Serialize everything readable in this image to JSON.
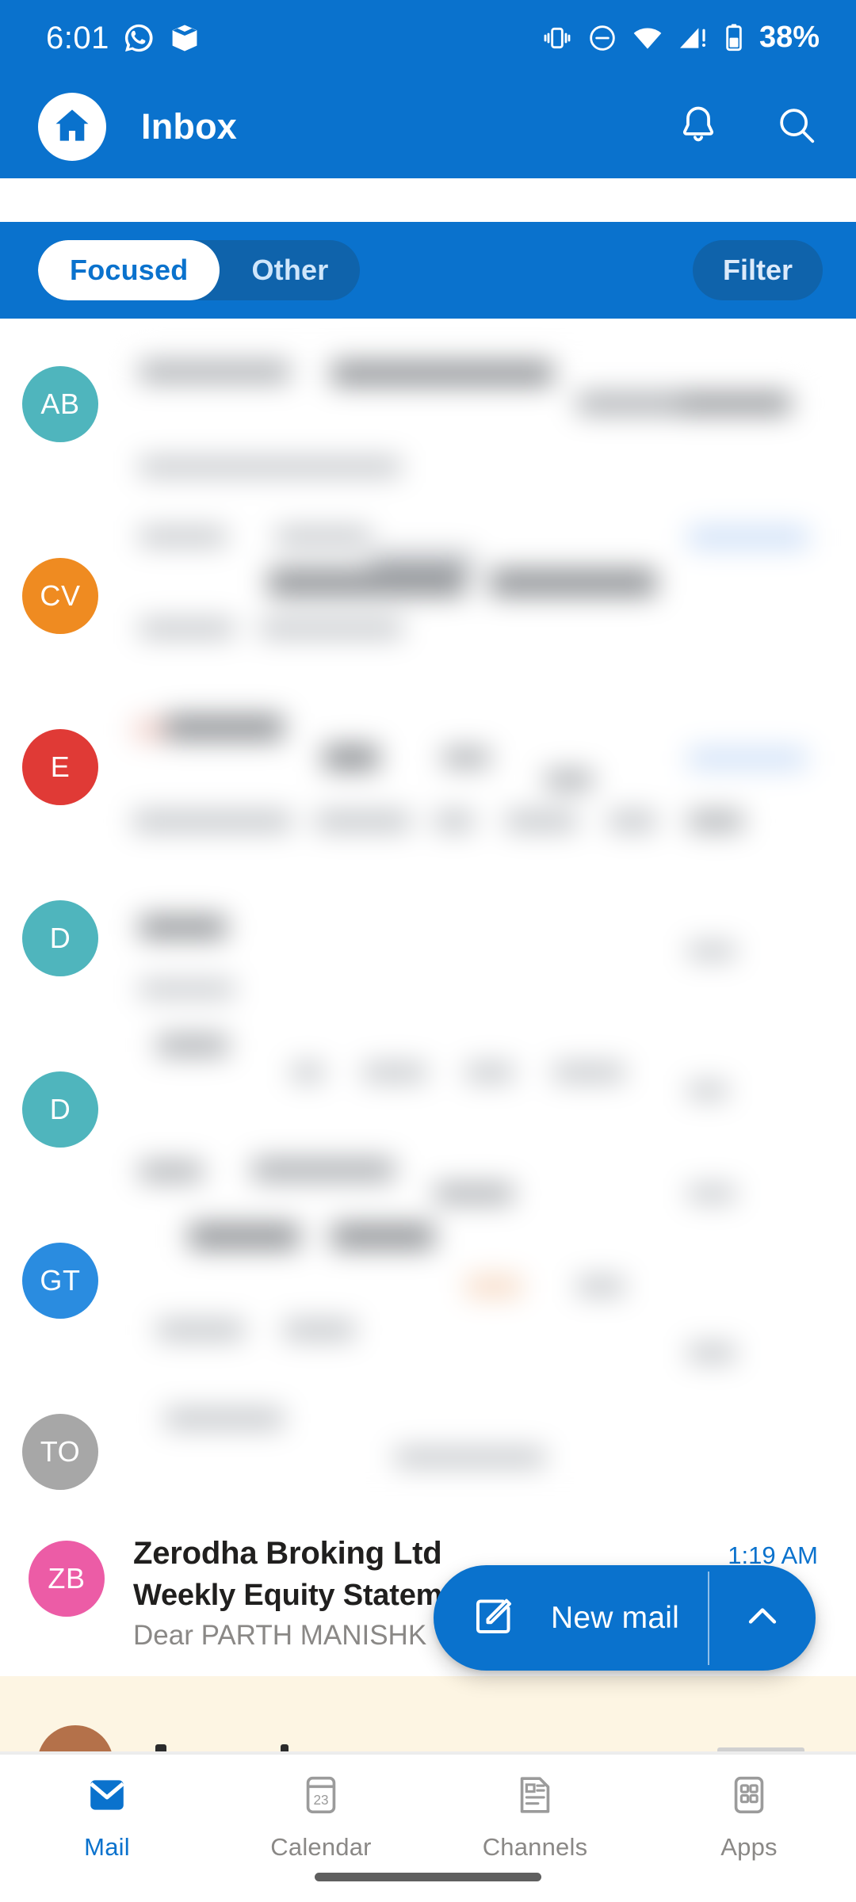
{
  "status_bar": {
    "time": "6:01",
    "battery_percent": "38%",
    "icons": [
      "whatsapp-icon",
      "package-icon",
      "vibrate-icon",
      "do-not-disturb-icon",
      "wifi-icon",
      "cellular-signal-alert-icon",
      "battery-icon"
    ]
  },
  "app_bar": {
    "home_icon": "home-icon",
    "title": "Inbox",
    "notifications_icon": "bell-icon",
    "search_icon": "search-icon"
  },
  "filter_bar": {
    "tabs": [
      {
        "label": "Focused",
        "active": true
      },
      {
        "label": "Other",
        "active": false
      }
    ],
    "filter_label": "Filter"
  },
  "message_list": {
    "redacted_note": "blurred message content",
    "avatars": [
      {
        "initials": "AB",
        "color": "#4fb5bd"
      },
      {
        "initials": "CV",
        "color": "#ef8b21"
      },
      {
        "initials": "E",
        "color": "#e03a36"
      },
      {
        "initials": "D",
        "color": "#4fb5bd"
      },
      {
        "initials": "D",
        "color": "#4fb5bd"
      },
      {
        "initials": "GT",
        "color": "#2a8ce0"
      },
      {
        "initials": "TO",
        "color": "#a7a7a7"
      }
    ],
    "visible_message": {
      "avatar_initials": "ZB",
      "avatar_color": "#ec5ca6",
      "sender": "Zerodha Broking Ltd",
      "subject": "Weekly Equity Statem",
      "preview": "Dear PARTH MANISHK",
      "time": "1:19 AM"
    },
    "flagged_row": {
      "avatar_color": "#b4714a",
      "background": "#fdf5e3"
    }
  },
  "fab": {
    "compose_icon": "compose-icon",
    "label": "New mail",
    "expand_icon": "chevron-up-icon"
  },
  "bottom_nav": {
    "items": [
      {
        "label": "Mail",
        "icon": "mail-icon",
        "active": true
      },
      {
        "label": "Calendar",
        "icon": "calendar-icon",
        "badge": "23",
        "active": false
      },
      {
        "label": "Channels",
        "icon": "channels-icon",
        "active": false
      },
      {
        "label": "Apps",
        "icon": "apps-icon",
        "active": false
      }
    ]
  },
  "colors": {
    "brand_blue": "#0a72cd",
    "brand_blue_dark": "#0f63ab",
    "text_primary": "#201f1e",
    "text_secondary": "#8a8886"
  }
}
